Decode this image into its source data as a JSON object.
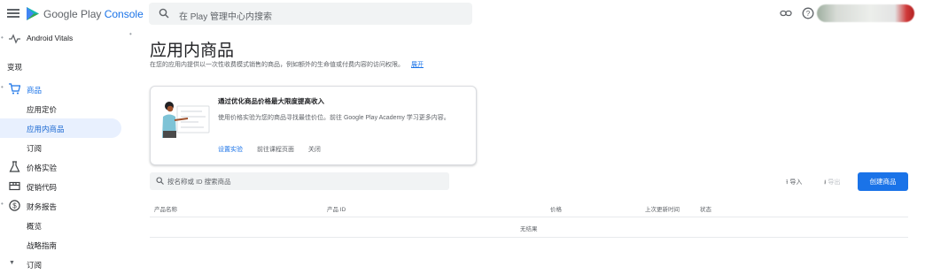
{
  "app": {
    "brand_main": "Google Play",
    "brand_accent": "Console",
    "search_placeholder": "在 Play 管理中心内搜索"
  },
  "colors": {
    "accent": "#1a73e8",
    "active_bg": "#e8f0fe"
  },
  "sidebar": {
    "top_item": "Android Vitals",
    "section": "变现",
    "items": [
      {
        "label": "商品",
        "icon": "cart-icon"
      },
      {
        "label": "应用定价"
      },
      {
        "label": "应用内商品"
      },
      {
        "label": "订阅"
      },
      {
        "label": "价格实验",
        "icon": "flask-icon"
      },
      {
        "label": "促销代码",
        "icon": "promo-icon"
      },
      {
        "label": "财务报告",
        "icon": "dollar-icon"
      },
      {
        "label": "概览"
      },
      {
        "label": "战略指南"
      },
      {
        "label": "订阅"
      }
    ]
  },
  "page": {
    "title": "应用内商品",
    "subtitle": "在您的应用内提供以一次性收费模式销售的商品，例如额外的生命值或付费内容的访问权限。",
    "expand_link": "展开"
  },
  "card": {
    "title": "通过优化商品价格最大限度提高收入",
    "body": "使用价格实验为您的商品寻找最佳价位。前往 Google Play Academy 学习更多内容。",
    "action_primary": "设置实验",
    "action_secondary": "前往课程页面",
    "action_close": "关闭"
  },
  "toolbar": {
    "filter_placeholder": "按名称或 ID 搜索商品",
    "import": "导入",
    "export": "导出",
    "create": "创建商品"
  },
  "table": {
    "columns": [
      "产品名称",
      "产品 ID",
      "价格",
      "上次更新时间",
      "状态"
    ],
    "empty": "无结果"
  }
}
